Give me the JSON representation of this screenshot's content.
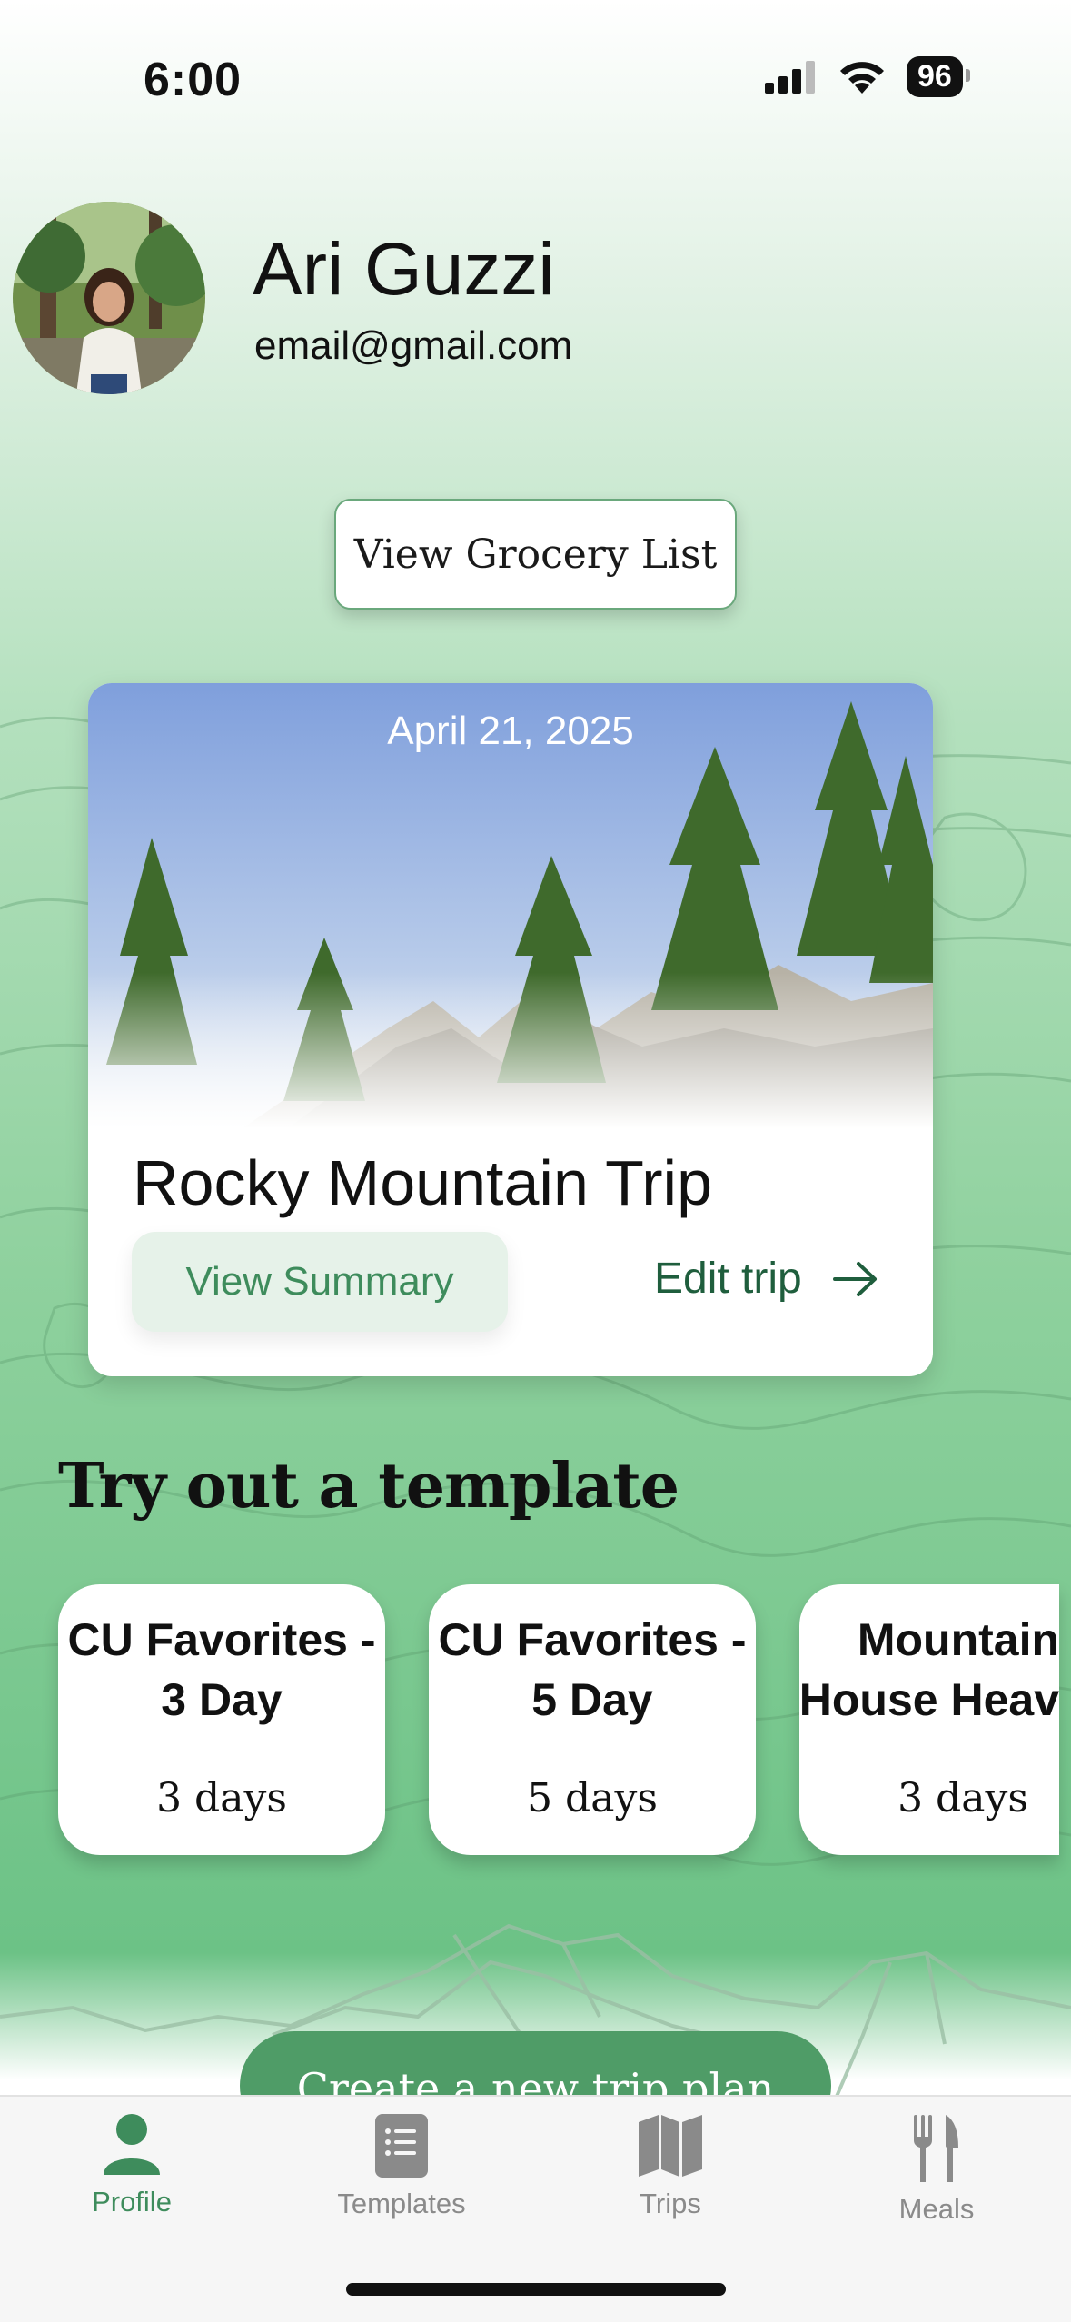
{
  "status_bar": {
    "time": "6:00",
    "battery": "96"
  },
  "profile": {
    "name": "Ari Guzzi",
    "email": "email@gmail.com"
  },
  "grocery_button_label": "View Grocery List",
  "trip_card": {
    "date": "April 21, 2025",
    "title": "Rocky Mountain Trip",
    "summary_label": "View Summary",
    "edit_label": "Edit trip"
  },
  "templates_heading": "Try out a template",
  "templates": [
    {
      "name": "CU Favorites -\n3 Day",
      "days": "3 days"
    },
    {
      "name": "CU Favorites -\n5 Day",
      "days": "5 days"
    },
    {
      "name": "Mountain\nHouse Heav",
      "days": "3 days"
    }
  ],
  "create_button_label": "Create a new trip plan",
  "tabs": [
    {
      "label": "Profile",
      "icon": "person-icon",
      "active": true
    },
    {
      "label": "Templates",
      "icon": "list-icon",
      "active": false
    },
    {
      "label": "Trips",
      "icon": "map-icon",
      "active": false
    },
    {
      "label": "Meals",
      "icon": "fork-knife-icon",
      "active": false
    }
  ],
  "colors": {
    "accent": "#3e8c5c",
    "button_green": "#4f9c67",
    "edit_text": "#1f5e3d"
  }
}
